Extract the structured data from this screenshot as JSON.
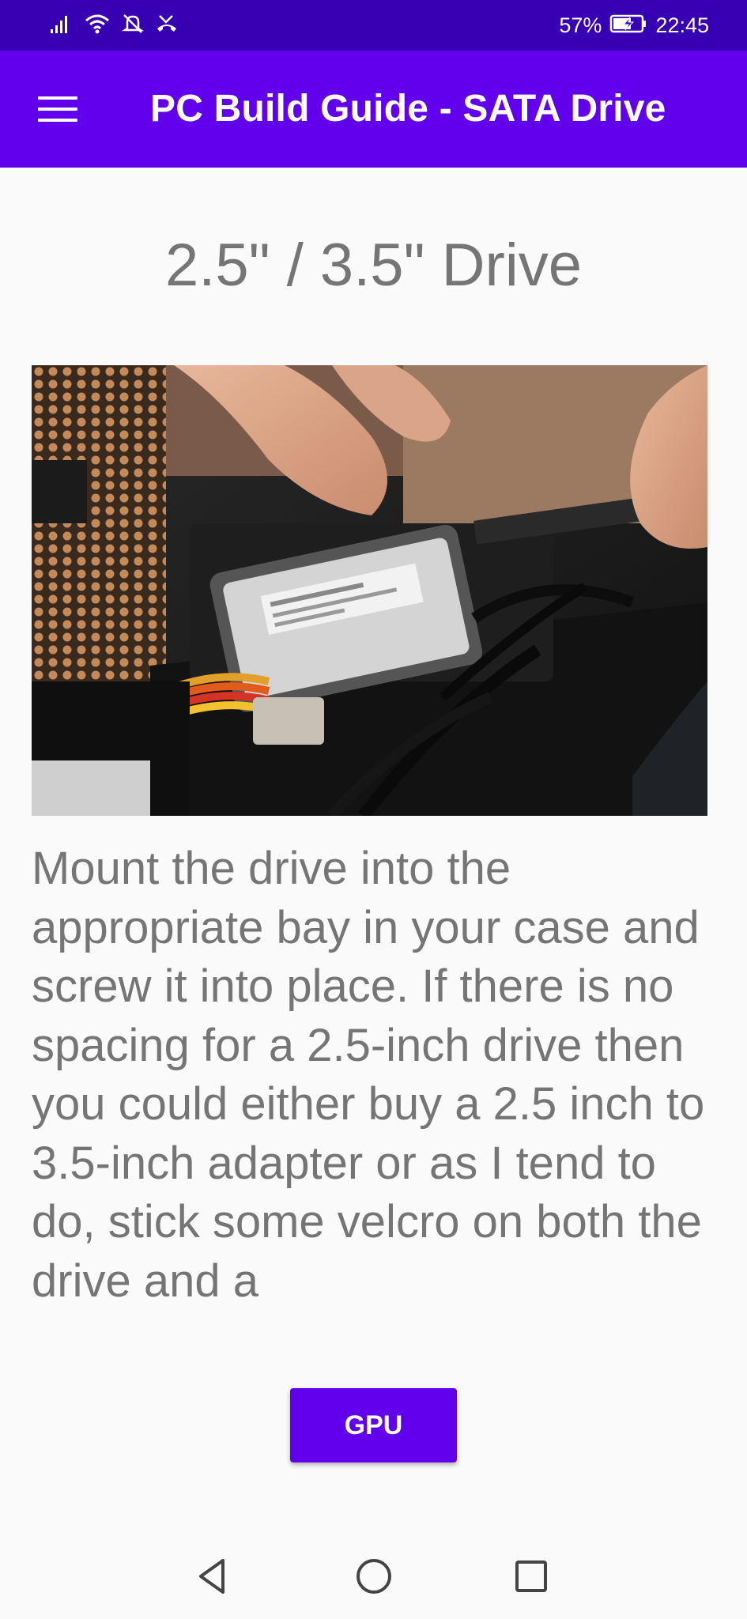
{
  "status_bar": {
    "battery_percent": "57%",
    "time": "22:45",
    "icons": [
      "signal-icon",
      "wifi-icon",
      "bell-muted-icon",
      "missed-call-icon",
      "battery-charging-icon"
    ]
  },
  "app_bar": {
    "title": "PC Build Guide - SATA Drive",
    "menu_icon": "menu-icon"
  },
  "main": {
    "heading": "2.5\" / 3.5\" Drive",
    "image": "photo of a 2.5-inch hard drive being mounted in a PC case",
    "body": "Mount the drive into the appropriate bay in your case and screw it into place. If there is no spacing for a 2.5-inch drive then you could either buy a 2.5 inch to 3.5-inch adapter or as I tend to do, stick some velcro on both the drive and a",
    "next_button_label": "GPU"
  },
  "nav_bar": {
    "icons": [
      "back-icon",
      "home-icon",
      "recents-icon"
    ]
  },
  "colors": {
    "status_bar": "#3700b3",
    "app_bar": "#6200ee",
    "button": "#6200ee",
    "text_secondary": "#757575",
    "background": "#fafafa"
  }
}
